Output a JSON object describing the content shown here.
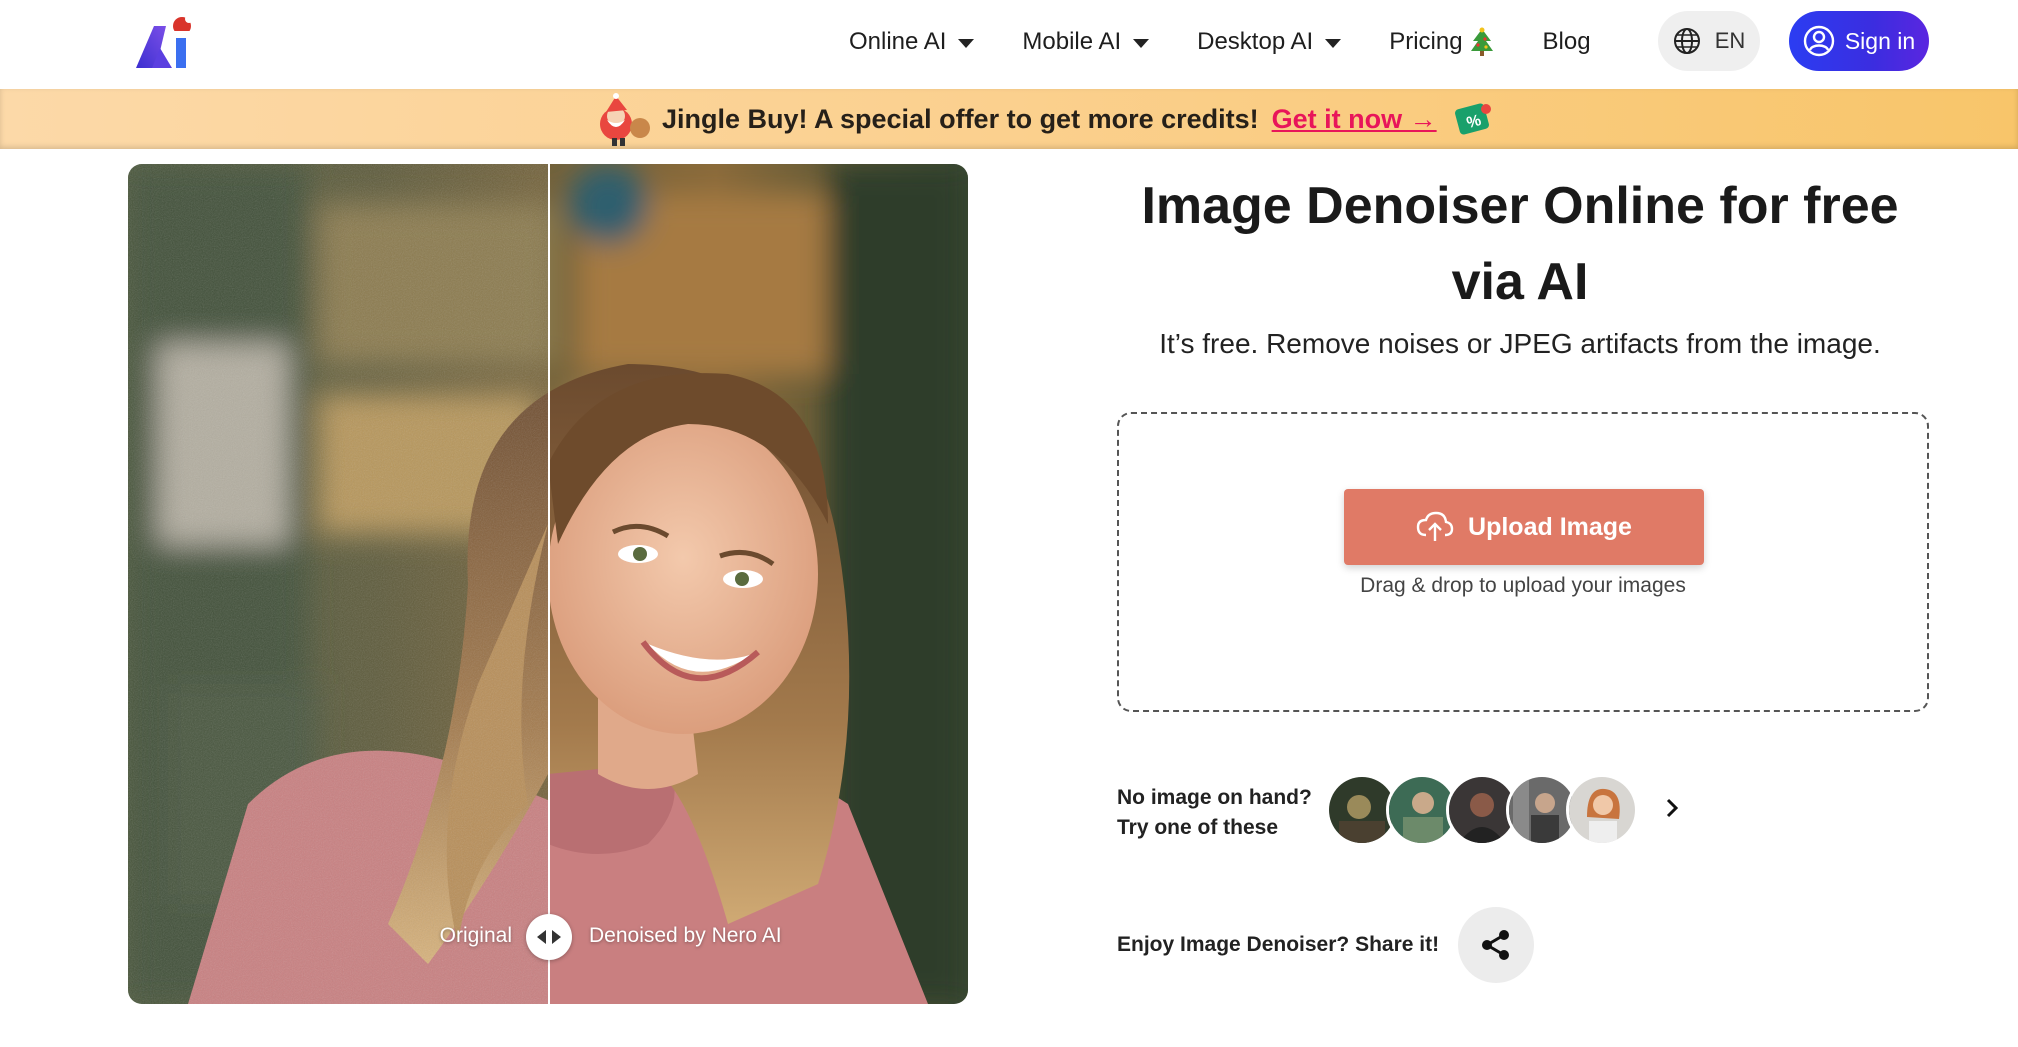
{
  "header": {
    "nav": [
      {
        "label": "Online AI",
        "has_dropdown": true
      },
      {
        "label": "Mobile AI",
        "has_dropdown": true
      },
      {
        "label": "Desktop AI",
        "has_dropdown": true
      },
      {
        "label": "Pricing",
        "icon": "christmas-tree-icon"
      },
      {
        "label": "Blog"
      }
    ],
    "language": "EN",
    "signin_label": "Sign in"
  },
  "promo": {
    "text": "Jingle Buy! A special offer to get more credits!",
    "link": "Get it now →"
  },
  "compare": {
    "left_label": "Original",
    "right_label": "Denoised by Nero AI"
  },
  "hero": {
    "title_line1": "Image Denoiser Online for free",
    "title_line2": "via AI",
    "subtitle": "It’s free. Remove noises or JPEG artifacts from the image."
  },
  "upload": {
    "button_label": "Upload Image",
    "hint": "Drag & drop to upload your images"
  },
  "samples": {
    "prompt_line1": "No image on hand?",
    "prompt_line2": "Try one of these"
  },
  "share": {
    "text": "Enjoy Image Denoiser? Share it!"
  },
  "colors": {
    "accent": "#2b3df2",
    "upload": "#e07a66",
    "promo_link": "#e8155a"
  }
}
